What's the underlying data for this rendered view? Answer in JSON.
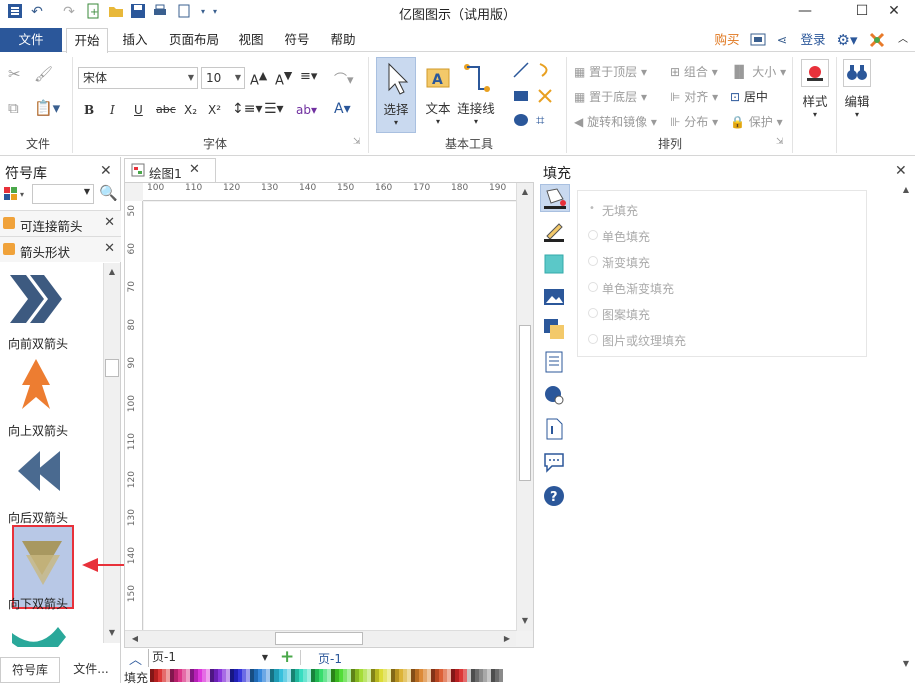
{
  "window": {
    "title": "亿图图示（试用版）"
  },
  "menu": {
    "file": "文件",
    "tabs": [
      "开始",
      "插入",
      "页面布局",
      "视图",
      "符号",
      "帮助"
    ],
    "right": {
      "buy": "购买",
      "login": "登录"
    }
  },
  "ribbon": {
    "groups": {
      "file": "文件",
      "font": "字体",
      "basic_tools": "基本工具",
      "arrange": "排列"
    },
    "font_name": "宋体",
    "font_size": "10",
    "tools": {
      "select": "选择",
      "text": "文本",
      "connector": "连接线"
    },
    "arrange": {
      "bring_top": "置于顶层",
      "send_bottom": "置于底层",
      "rotate_mirror": "旋转和镜像",
      "group": "组合",
      "align": "对齐",
      "distribute": "分布",
      "size": "大小",
      "center": "居中",
      "protect": "保护"
    },
    "style": "样式",
    "edit": "编辑"
  },
  "left_panel": {
    "title": "符号库",
    "libraries": [
      "可连接箭头",
      "箭头形状"
    ],
    "shapes": [
      "向前双箭头",
      "向上双箭头",
      "向后双箭头",
      "向下双箭头"
    ],
    "bottom_tabs": [
      "符号库",
      "文件..."
    ]
  },
  "document": {
    "tab": "绘图1",
    "hruler": [
      "100",
      "110",
      "120",
      "130",
      "140",
      "150",
      "160",
      "170",
      "180",
      "190"
    ],
    "vruler": [
      "50",
      "60",
      "70",
      "80",
      "90",
      "100",
      "110",
      "120",
      "130",
      "140",
      "150"
    ],
    "page_select": "页-1",
    "page_tab": "页-1",
    "fill_label": "填充"
  },
  "fill_panel": {
    "title": "填充",
    "options": [
      "无填充",
      "单色填充",
      "渐变填充",
      "单色渐变填充",
      "图案填充",
      "图片或纹理填充"
    ]
  },
  "colors": {
    "accent": "#2b579a",
    "highlight": "#e8313a",
    "selected_bg": "#b8c8e6"
  }
}
